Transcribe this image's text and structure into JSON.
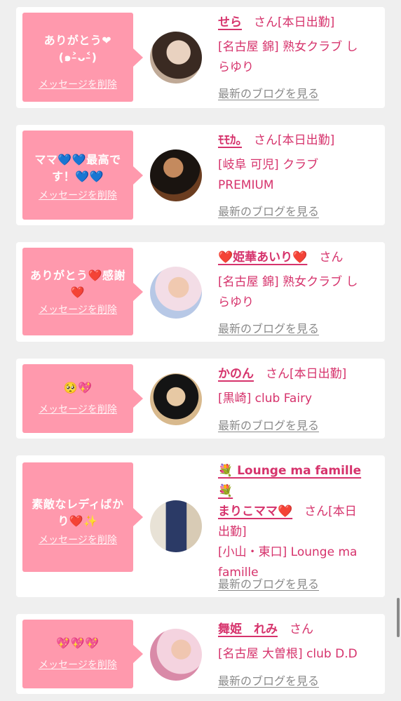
{
  "delete_label": "メッセージを削除",
  "blog_label": "最新のブログを見る",
  "san": "さん",
  "cards": [
    {
      "message_l1": "ありがとう❤︎(๑˃̵ᴗ˂̵)",
      "message_l2": "",
      "name": "せら",
      "tag": "[本日出勤]",
      "shop_l1": "[名古屋 錦] 熟女クラブ し",
      "shop_l2": "らゆり",
      "avatar_colors": [
        "#3a2a22",
        "#d9c7b5"
      ]
    },
    {
      "message_l1": "ママ💙💙最高で",
      "message_l2": "す！💙💙",
      "name": "ﾓﾓｶ｡",
      "tag": "[本日出勤]",
      "shop_l1": "[岐阜 可児] クラブ",
      "shop_l2": "PREMIUM",
      "avatar_colors": [
        "#1a1410",
        "#a56a3a"
      ]
    },
    {
      "message_l1": "ありがとう❤️感謝",
      "message_l2": "❤️",
      "name": "❤️姫華あいり❤️",
      "tag": "",
      "shop_l1": "[名古屋 錦] 熟女クラブ し",
      "shop_l2": "らゆり",
      "avatar_colors": [
        "#f3dde6",
        "#b7c8e6"
      ]
    },
    {
      "message_l1": "🥺💖",
      "message_l2": "",
      "name": "かのん",
      "tag": "[本日出勤]",
      "shop_l1": "[黒崎] club Fairy",
      "shop_l2": "",
      "avatar_colors": [
        "#141414",
        "#d8b98d"
      ]
    },
    {
      "message_l1": "素敵なレディばか",
      "message_l2": "り❤️✨",
      "name_l1": "💐 Lounge ma famille💐",
      "name": "まりこママ❤️",
      "tag": "[本日",
      "tag2": "出勤]",
      "shop_l1": "[小山・東口] Lounge ma",
      "shop_l2": "famille",
      "avatar_colors": [
        "#2b3a66",
        "#e8e2d6"
      ]
    },
    {
      "message_l1": "💖💖💖",
      "message_l2": "",
      "name": "舞姫　れみ",
      "tag": "",
      "shop_l1": "[名古屋 大曽根] club D.D",
      "shop_l2": "",
      "avatar_colors": [
        "#f4d3df",
        "#d98aa8"
      ]
    }
  ]
}
